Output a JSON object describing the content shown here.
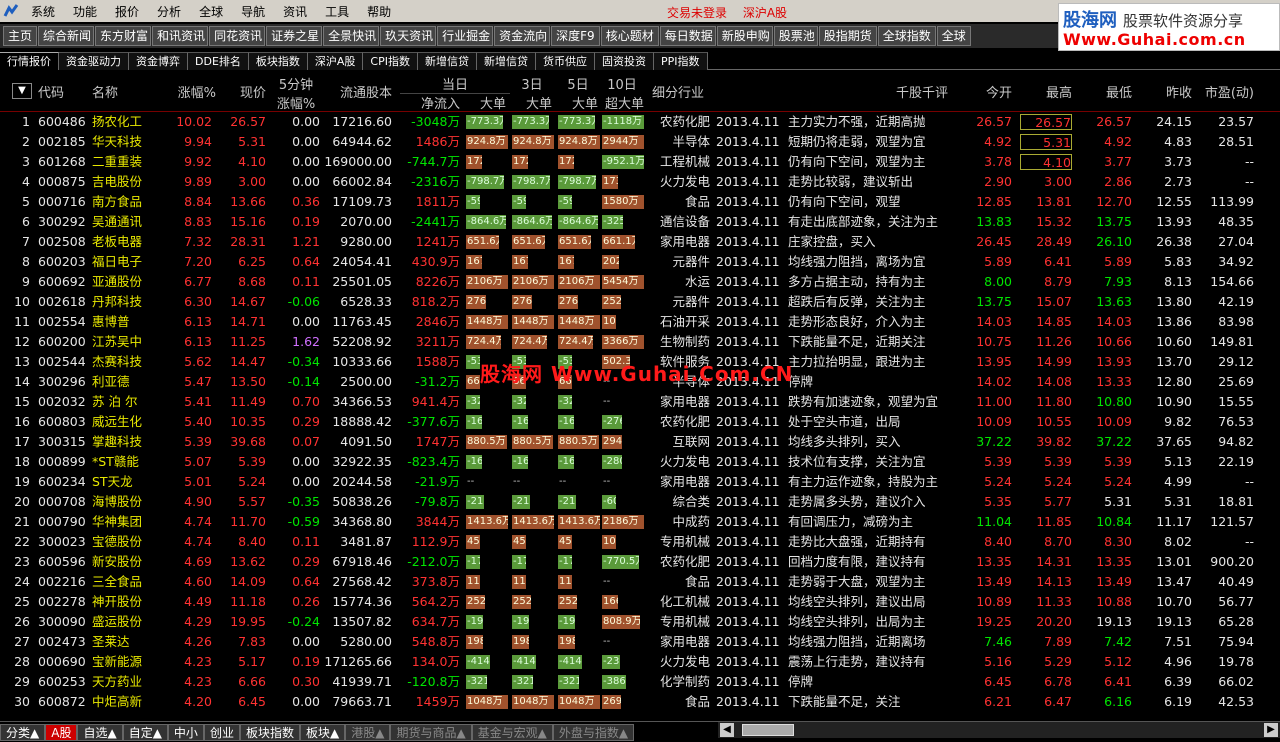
{
  "menubar": {
    "items": [
      "系统",
      "功能",
      "报价",
      "分析",
      "全球",
      "导航",
      "资讯",
      "工具",
      "帮助"
    ],
    "status1": "交易未登录",
    "status2": "深沪A股"
  },
  "brand": {
    "l1a": "股海网",
    "l1b": "股票软件资源分享",
    "l2": "Www.Guhai.com.cn"
  },
  "toolbar": {
    "buttons": [
      "主页",
      "综合新闻",
      "东方财富",
      "和讯资讯",
      "同花资讯",
      "证券之星",
      "全景快讯",
      "玖天资讯",
      "行业掘金",
      "资金流向",
      "深度F9",
      "核心题材",
      "每日数据",
      "新股申购",
      "股票池",
      "股指期货",
      "全球指数",
      "全球"
    ]
  },
  "tabs": [
    "行情报价",
    "资金驱动力",
    "资金博弈",
    "DDE排名",
    "板块指数",
    "深沪A股",
    "CPI指数",
    "新增信贷",
    "新增信贷",
    "货币供应",
    "固资投资",
    "PPI指数"
  ],
  "header": {
    "code": "代码",
    "name": "名称",
    "chg": "涨幅%",
    "price": "现价",
    "m5a": "5分钟",
    "m5b": "涨幅%",
    "float": "流通股本",
    "today": "当日",
    "netin": "净流入",
    "big1": "大单",
    "d3": "3日",
    "big3": "大单",
    "d5": "5日",
    "big5": "大单",
    "d10": "10日",
    "super10": "超大单",
    "ind": "细分行业",
    "comment": "千股千评",
    "open": "今开",
    "high": "最高",
    "low": "最低",
    "prev": "昨收",
    "pe": "市盈(动)"
  },
  "rows": [
    [
      "1",
      "600486",
      "扬农化工",
      "10.02",
      "26.57",
      "0.00",
      "17216.60",
      "-3048万",
      "-773.3万",
      "-773.3万",
      "-773.3万",
      "-1118万",
      "农药化肥",
      "2013.4.11",
      "主力实力不强，近期高抛",
      "26.57",
      "26.57",
      "26.57",
      "24.15",
      "23.57"
    ],
    [
      "2",
      "002185",
      "华天科技",
      "9.94",
      "5.31",
      "0.00",
      "64944.62",
      "1486万",
      "924.8万",
      "924.8万",
      "924.8万",
      "2944万",
      "半导体",
      "2013.4.11",
      "短期仍将走弱，观望为宜",
      "4.92",
      "5.31",
      "4.92",
      "4.83",
      "28.51"
    ],
    [
      "3",
      "601268",
      "二重重装",
      "9.92",
      "4.10",
      "0.00",
      "169000.00",
      "-744.7万",
      "172.8万",
      "172.8万",
      "172.8万",
      "-952.1万",
      "工程机械",
      "2013.4.11",
      "仍有向下空间，观望为主",
      "3.78",
      "4.10",
      "3.77",
      "3.73",
      "--"
    ],
    [
      "4",
      "000875",
      "吉电股份",
      "9.89",
      "3.00",
      "0.00",
      "66002.84",
      "-2316万",
      "-798.7万",
      "-798.7万",
      "-798.7万",
      "173.6万",
      "火力发电",
      "2013.4.11",
      "走势比较弱，建议斩出",
      "2.90",
      "3.00",
      "2.86",
      "2.73",
      "--"
    ],
    [
      "5",
      "000716",
      "南方食品",
      "8.84",
      "13.66",
      "0.36",
      "17109.73",
      "1811万",
      "-59.1万",
      "-59.1万",
      "-59.1万",
      "1580万",
      "食品",
      "2013.4.11",
      "仍有向下空间，观望",
      "12.85",
      "13.81",
      "12.70",
      "12.55",
      "113.99"
    ],
    [
      "6",
      "300292",
      "吴通通讯",
      "8.83",
      "15.16",
      "0.19",
      "2070.00",
      "-2441万",
      "-864.6万",
      "-864.6万",
      "-864.6万",
      "-325.9万",
      "通信设备",
      "2013.4.11",
      "有走出底部迹象，关注为主",
      "13.83",
      "15.32",
      "13.75",
      "13.93",
      "48.35"
    ],
    [
      "7",
      "002508",
      "老板电器",
      "7.32",
      "28.31",
      "1.21",
      "9280.00",
      "1241万",
      "651.6万",
      "651.6万",
      "651.6万",
      "661.1万",
      "家用电器",
      "2013.4.11",
      "庄家控盘，买入",
      "26.45",
      "28.49",
      "26.10",
      "26.38",
      "27.04"
    ],
    [
      "8",
      "600203",
      "福日电子",
      "7.20",
      "6.25",
      "0.64",
      "24054.41",
      "430.9万",
      "167.9万",
      "167.9万",
      "167.9万",
      "202.8万",
      "元器件",
      "2013.4.11",
      "均线强力阻挡，离场为宜",
      "5.89",
      "6.41",
      "5.89",
      "5.83",
      "34.92"
    ],
    [
      "9",
      "600692",
      "亚通股份",
      "6.77",
      "8.68",
      "0.11",
      "25501.05",
      "8226万",
      "2106万",
      "2106万",
      "2106万",
      "5454万",
      "水运",
      "2013.4.11",
      "多方占据主动，持有为主",
      "8.00",
      "8.79",
      "7.93",
      "8.13",
      "154.66"
    ],
    [
      "10",
      "002618",
      "丹邦科技",
      "6.30",
      "14.67",
      "-0.06",
      "6528.33",
      "818.2万",
      "276.2万",
      "276.2万",
      "276.2万",
      "252.0万",
      "元器件",
      "2013.4.11",
      "超跌后有反弹，关注为主",
      "13.75",
      "15.07",
      "13.63",
      "13.80",
      "42.19"
    ],
    [
      "11",
      "002554",
      "惠博普",
      "6.13",
      "14.71",
      "0.00",
      "11763.45",
      "2846万",
      "1448万",
      "1448万",
      "1448万",
      "109.8万",
      "石油开采",
      "2013.4.11",
      "走势形态良好，介入为主",
      "14.03",
      "14.85",
      "14.03",
      "13.86",
      "83.98"
    ],
    [
      "12",
      "600200",
      "江苏吴中",
      "6.13",
      "11.25",
      "1.62",
      "52208.92",
      "3211万",
      "724.4万",
      "724.4万",
      "724.4万",
      "3366万",
      "生物制药",
      "2013.4.11",
      "下跌能量不足，近期关注",
      "10.75",
      "11.26",
      "10.66",
      "10.60",
      "149.81"
    ],
    [
      "13",
      "002544",
      "杰赛科技",
      "5.62",
      "14.47",
      "-0.34",
      "10333.66",
      "1588万",
      "-53.4万",
      "-53.4万",
      "-53.4万",
      "502.3万",
      "软件服务",
      "2013.4.11",
      "主力拉抬明显，跟进为主",
      "13.95",
      "14.99",
      "13.93",
      "13.70",
      "29.12"
    ],
    [
      "14",
      "300296",
      "利亚德",
      "5.47",
      "13.50",
      "-0.14",
      "2500.00",
      "-31.2万",
      "66.0万",
      "66.0万",
      "66.0万",
      "--",
      "半导体",
      "2013.4.11",
      "停牌",
      "14.02",
      "14.08",
      "13.33",
      "12.80",
      "25.69"
    ],
    [
      "15",
      "002032",
      "苏 泊 尔",
      "5.41",
      "11.49",
      "0.70",
      "34366.53",
      "941.4万",
      "-32.3万",
      "-32.3万",
      "-32.3万",
      "--",
      "家用电器",
      "2013.4.11",
      "跌势有加速迹象，观望为宜",
      "11.00",
      "11.80",
      "10.80",
      "10.90",
      "15.55"
    ],
    [
      "16",
      "600803",
      "威远生化",
      "5.40",
      "10.35",
      "0.29",
      "18888.42",
      "-377.6万",
      "-162.2万",
      "-162.2万",
      "-162.2万",
      "-276.2万",
      "农药化肥",
      "2013.4.11",
      "处于空头市道，出局",
      "10.09",
      "10.55",
      "10.09",
      "9.82",
      "76.53"
    ],
    [
      "17",
      "300315",
      "掌趣科技",
      "5.39",
      "39.68",
      "0.07",
      "4091.50",
      "1747万",
      "880.5万",
      "880.5万",
      "880.5万",
      "294.2万",
      "互联网",
      "2013.4.11",
      "均线多头排列，买入",
      "37.22",
      "39.82",
      "37.22",
      "37.65",
      "94.82"
    ],
    [
      "18",
      "000899",
      "*ST赣能",
      "5.07",
      "5.39",
      "0.00",
      "32922.35",
      "-823.4万",
      "-162.7万",
      "-162.7万",
      "-162.7万",
      "-280.6万",
      "火力发电",
      "2013.4.11",
      "技术位有支撑，关注为宜",
      "5.39",
      "5.39",
      "5.39",
      "5.13",
      "22.19"
    ],
    [
      "19",
      "600234",
      "ST天龙",
      "5.01",
      "5.24",
      "0.00",
      "20244.58",
      "-21.9万",
      "--",
      "--",
      "--",
      "--",
      "家用电器",
      "2013.4.11",
      "有主力运作迹象，持股为主",
      "5.24",
      "5.24",
      "5.24",
      "4.99",
      "--"
    ],
    [
      "20",
      "000708",
      "海博股份",
      "4.90",
      "5.57",
      "-0.35",
      "50838.26",
      "-79.8万",
      "-215.7万",
      "-215.7万",
      "-215.7万",
      "-60.7万",
      "综合类",
      "2013.4.11",
      "走势属多头势，建议介入",
      "5.35",
      "5.77",
      "5.31",
      "5.31",
      "18.81"
    ],
    [
      "21",
      "000790",
      "华神集团",
      "4.74",
      "11.70",
      "-0.59",
      "34368.80",
      "3844万",
      "1413.6万",
      "1413.6万",
      "1413.6万",
      "2186万",
      "中成药",
      "2013.4.11",
      "有回调压力，减磅为主",
      "11.04",
      "11.85",
      "10.84",
      "11.17",
      "121.57"
    ],
    [
      "22",
      "300023",
      "宝德股份",
      "4.74",
      "8.40",
      "0.11",
      "3481.87",
      "112.9万",
      "45.3万",
      "45.3万",
      "45.3万",
      "100.5万",
      "专用机械",
      "2013.4.11",
      "走势比大盘强，近期持有",
      "8.40",
      "8.70",
      "8.30",
      "8.02",
      "--"
    ],
    [
      "23",
      "600596",
      "新安股份",
      "4.69",
      "13.62",
      "0.29",
      "67918.46",
      "-212.0万",
      "-17.4万",
      "-17.4万",
      "-17.4万",
      "-770.5万",
      "农药化肥",
      "2013.4.11",
      "回档力度有限，建议持有",
      "13.35",
      "14.31",
      "13.35",
      "13.01",
      "900.20"
    ],
    [
      "24",
      "002216",
      "三全食品",
      "4.60",
      "14.09",
      "0.64",
      "27568.42",
      "373.8万",
      "113.0万",
      "113.0万",
      "113.0万",
      "--",
      "食品",
      "2013.4.11",
      "走势弱于大盘，观望为主",
      "13.49",
      "14.13",
      "13.49",
      "13.47",
      "40.49"
    ],
    [
      "25",
      "002278",
      "神开股份",
      "4.49",
      "11.18",
      "0.26",
      "15774.36",
      "564.2万",
      "252.8万",
      "252.8万",
      "252.8万",
      "166.0万",
      "化工机械",
      "2013.4.11",
      "均线空头排列，建议出局",
      "10.89",
      "11.33",
      "10.88",
      "10.70",
      "56.77"
    ],
    [
      "26",
      "300090",
      "盛运股份",
      "4.29",
      "19.95",
      "-0.24",
      "13507.82",
      "634.7万",
      "-194.1万",
      "-194.1万",
      "-194.1万",
      "808.9万",
      "专用机械",
      "2013.4.11",
      "均线空头排列，出局为主",
      "19.25",
      "20.20",
      "19.13",
      "19.13",
      "65.28"
    ],
    [
      "27",
      "002473",
      "圣莱达",
      "4.26",
      "7.83",
      "0.00",
      "5280.00",
      "548.8万",
      "198.7万",
      "198.7万",
      "198.7万",
      "--",
      "家用电器",
      "2013.4.11",
      "均线强力阻挡，近期离场",
      "7.46",
      "7.89",
      "7.42",
      "7.51",
      "75.94"
    ],
    [
      "28",
      "000690",
      "宝新能源",
      "4.23",
      "5.17",
      "0.19",
      "171265.66",
      "134.0万",
      "-414.2万",
      "-414.2万",
      "-414.2万",
      "-238.7万",
      "火力发电",
      "2013.4.11",
      "震荡上行走势，建议持有",
      "5.16",
      "5.29",
      "5.12",
      "4.96",
      "19.78"
    ],
    [
      "29",
      "600253",
      "天方药业",
      "4.23",
      "6.66",
      "0.30",
      "41939.71",
      "-120.8万",
      "-321.3万",
      "-321.3万",
      "-321.3万",
      "-386.7万",
      "化学制药",
      "2013.4.11",
      "停牌",
      "6.45",
      "6.78",
      "6.41",
      "6.39",
      "66.02"
    ],
    [
      "30",
      "600872",
      "中炬高新",
      "4.20",
      "6.45",
      "0.00",
      "79663.71",
      "1459万",
      "1048万",
      "1048万",
      "1048万",
      "269.4万",
      "食品",
      "2013.4.11",
      "下跌能量不足，关注",
      "6.21",
      "6.47",
      "6.16",
      "6.19",
      "42.53"
    ]
  ],
  "statusbar": {
    "tabs": [
      "分类▲",
      "A股",
      "自选▲",
      "自定▲",
      "中小",
      "创业",
      "板块指数",
      "板块▲",
      "港股▲",
      "期货与商品▲",
      "基金与宏观▲",
      "外盘与指数▲"
    ]
  },
  "watermark": "股海网 Www.Guhai.Com.CN",
  "colors": {
    "up": "#ff3232",
    "down": "#00e600",
    "bar_up": "#a0522d",
    "bar_down": "#5a9a3a"
  }
}
